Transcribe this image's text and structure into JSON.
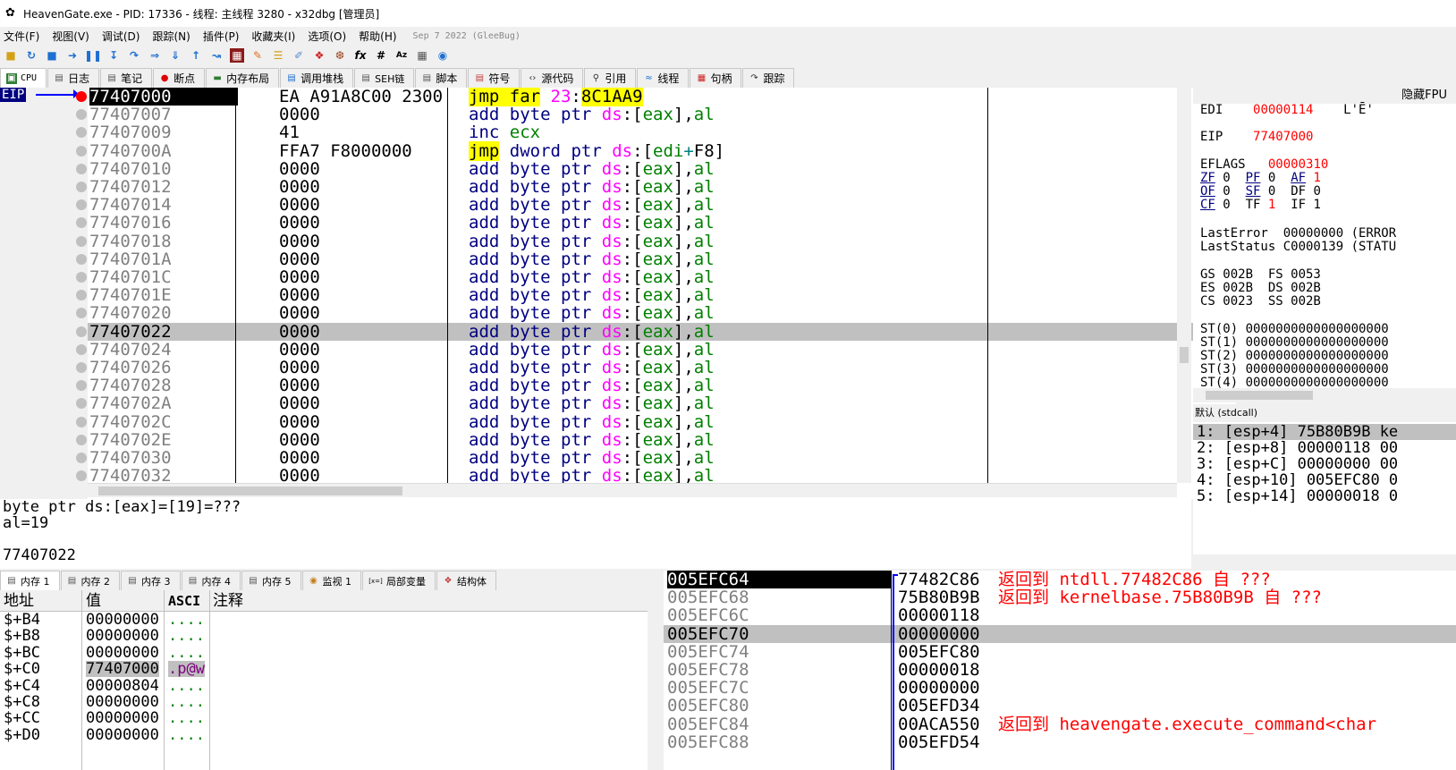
{
  "window": {
    "title": "HeavenGate.exe - PID: 17336 - 线程: 主线程 3280 - x32dbg [管理员]"
  },
  "menu": {
    "items": [
      "文件(F)",
      "视图(V)",
      "调试(D)",
      "跟踪(N)",
      "插件(P)",
      "收藏夹(I)",
      "选项(O)",
      "帮助(H)"
    ],
    "version": "Sep 7 2022 (GleeBug)"
  },
  "toolbar": {
    "icons": [
      "open-icon",
      "restart-icon",
      "stop-icon",
      "run-icon",
      "pause-icon",
      "step-into-icon",
      "step-over-icon",
      "trace-into-icon",
      "trace-over-icon",
      "run-to-user-icon",
      "run-to-return-icon",
      "break-icon",
      "patch-icon",
      "comment-icon",
      "label-icon",
      "bookmark-icon",
      "function-icon",
      "fx-icon",
      "hash-icon",
      "font-icon",
      "calculator-icon",
      "settings-icon"
    ],
    "fx": "fx",
    "hash": "#",
    "font": "Az"
  },
  "main_tabs": [
    {
      "label": "CPU",
      "icon": "cpu-icon",
      "active": true
    },
    {
      "label": "日志",
      "icon": "log-icon"
    },
    {
      "label": "笔记",
      "icon": "notes-icon"
    },
    {
      "label": "断点",
      "icon": "breakpoint-icon"
    },
    {
      "label": "内存布局",
      "icon": "memory-map-icon"
    },
    {
      "label": "调用堆栈",
      "icon": "callstack-icon"
    },
    {
      "label": "SEH链",
      "icon": "seh-icon"
    },
    {
      "label": "脚本",
      "icon": "script-icon"
    },
    {
      "label": "符号",
      "icon": "symbols-icon"
    },
    {
      "label": "源代码",
      "icon": "source-icon"
    },
    {
      "label": "引用",
      "icon": "references-icon"
    },
    {
      "label": "线程",
      "icon": "threads-icon"
    },
    {
      "label": "句柄",
      "icon": "handles-icon"
    },
    {
      "label": "跟踪",
      "icon": "trace-icon"
    }
  ],
  "disasm": {
    "eip_label": "EIP",
    "rows": [
      {
        "addr": "77407000",
        "bytes": "EA A91A8C00 2300",
        "instr": "jmp far 23:8C1AA9",
        "kind": "jmpfar",
        "current": true
      },
      {
        "addr": "77407007",
        "bytes": "0000",
        "instr": "add byte ptr ds:[eax],al",
        "kind": "add"
      },
      {
        "addr": "77407009",
        "bytes": "41",
        "instr": "inc ecx",
        "kind": "inc"
      },
      {
        "addr": "7740700A",
        "bytes": "FFA7 F8000000",
        "instr": "jmp dword ptr ds:[edi+F8]",
        "kind": "jmpdw"
      },
      {
        "addr": "77407010",
        "bytes": "0000",
        "instr": "add byte ptr ds:[eax],al",
        "kind": "add"
      },
      {
        "addr": "77407012",
        "bytes": "0000",
        "instr": "add byte ptr ds:[eax],al",
        "kind": "add"
      },
      {
        "addr": "77407014",
        "bytes": "0000",
        "instr": "add byte ptr ds:[eax],al",
        "kind": "add"
      },
      {
        "addr": "77407016",
        "bytes": "0000",
        "instr": "add byte ptr ds:[eax],al",
        "kind": "add"
      },
      {
        "addr": "77407018",
        "bytes": "0000",
        "instr": "add byte ptr ds:[eax],al",
        "kind": "add"
      },
      {
        "addr": "7740701A",
        "bytes": "0000",
        "instr": "add byte ptr ds:[eax],al",
        "kind": "add"
      },
      {
        "addr": "7740701C",
        "bytes": "0000",
        "instr": "add byte ptr ds:[eax],al",
        "kind": "add"
      },
      {
        "addr": "7740701E",
        "bytes": "0000",
        "instr": "add byte ptr ds:[eax],al",
        "kind": "add"
      },
      {
        "addr": "77407020",
        "bytes": "0000",
        "instr": "add byte ptr ds:[eax],al",
        "kind": "add"
      },
      {
        "addr": "77407022",
        "bytes": "0000",
        "instr": "add byte ptr ds:[eax],al",
        "kind": "add",
        "selected": true
      },
      {
        "addr": "77407024",
        "bytes": "0000",
        "instr": "add byte ptr ds:[eax],al",
        "kind": "add"
      },
      {
        "addr": "77407026",
        "bytes": "0000",
        "instr": "add byte ptr ds:[eax],al",
        "kind": "add"
      },
      {
        "addr": "77407028",
        "bytes": "0000",
        "instr": "add byte ptr ds:[eax],al",
        "kind": "add"
      },
      {
        "addr": "7740702A",
        "bytes": "0000",
        "instr": "add byte ptr ds:[eax],al",
        "kind": "add"
      },
      {
        "addr": "7740702C",
        "bytes": "0000",
        "instr": "add byte ptr ds:[eax],al",
        "kind": "add"
      },
      {
        "addr": "7740702E",
        "bytes": "0000",
        "instr": "add byte ptr ds:[eax],al",
        "kind": "add"
      },
      {
        "addr": "77407030",
        "bytes": "0000",
        "instr": "add byte ptr ds:[eax],al",
        "kind": "add"
      },
      {
        "addr": "77407032",
        "bytes": "0000",
        "instr": "add byte ptr ds:[eax],al",
        "kind": "add"
      }
    ]
  },
  "info": {
    "lines": [
      "byte ptr ds:[eax]=[19]=???",
      "al=19",
      "",
      "77407022"
    ]
  },
  "registers": {
    "header": "隐藏FPU",
    "edi": {
      "name": "EDI",
      "value": "00000114",
      "extra": "L'Ē'"
    },
    "eip": {
      "name": "EIP",
      "value": "77407000"
    },
    "eflags": {
      "name": "EFLAGS",
      "value": "00000310"
    },
    "flags": [
      [
        {
          "n": "ZF",
          "v": "0",
          "u": true,
          "red": false
        },
        {
          "n": "PF",
          "v": "0",
          "u": true,
          "red": false
        },
        {
          "n": "AF",
          "v": "1",
          "u": true,
          "red": true
        }
      ],
      [
        {
          "n": "OF",
          "v": "0",
          "u": true,
          "red": false
        },
        {
          "n": "SF",
          "v": "0",
          "u": true,
          "red": false
        },
        {
          "n": "DF",
          "v": "0",
          "u": false,
          "red": false
        }
      ],
      [
        {
          "n": "CF",
          "v": "0",
          "u": true,
          "red": false
        },
        {
          "n": "TF",
          "v": "1",
          "u": false,
          "red": true
        },
        {
          "n": "IF",
          "v": "1",
          "u": false,
          "red": false
        }
      ]
    ],
    "last_error": "LastError  00000000 (ERROR",
    "last_status": "LastStatus C0000139 (STATU",
    "segs": [
      "GS 002B  FS 0053",
      "ES 002B  DS 002B",
      "CS 0023  SS 002B"
    ],
    "st": [
      "ST(0) 0000000000000000000",
      "ST(1) 0000000000000000000",
      "ST(2) 0000000000000000000",
      "ST(3) 0000000000000000000",
      "ST(4) 0000000000000000000"
    ]
  },
  "callconv": {
    "header": "默认 (stdcall)",
    "rows": [
      "1: [esp+4] 75B80B9B ke",
      "2: [esp+8] 00000118 00",
      "3: [esp+C] 00000000 00",
      "4: [esp+10] 005EFC80 0",
      "5: [esp+14] 00000018 0"
    ]
  },
  "mem_tabs": [
    {
      "label": "内存 1",
      "active": true
    },
    {
      "label": "内存 2"
    },
    {
      "label": "内存 3"
    },
    {
      "label": "内存 4"
    },
    {
      "label": "内存 5"
    },
    {
      "label": "监视 1"
    },
    {
      "label": "局部变量",
      "prefix": "[x=]"
    },
    {
      "label": "结构体"
    }
  ],
  "memory": {
    "headers": [
      "地址",
      "值",
      "ASCI",
      "注释"
    ],
    "rows": [
      {
        "a": "$+B4",
        "v": "00000000",
        "s": "...."
      },
      {
        "a": "$+B8",
        "v": "00000000",
        "s": "...."
      },
      {
        "a": "$+BC",
        "v": "00000000",
        "s": "...."
      },
      {
        "a": "$+C0",
        "v": "77407000",
        "s": ".p@w",
        "hl": true
      },
      {
        "a": "$+C4",
        "v": "00000804",
        "s": "...."
      },
      {
        "a": "$+C8",
        "v": "00000000",
        "s": "...."
      },
      {
        "a": "$+CC",
        "v": "00000000",
        "s": "...."
      },
      {
        "a": "$+D0",
        "v": "00000000",
        "s": "...."
      }
    ]
  },
  "stack": {
    "rows": [
      {
        "a": "005EFC64",
        "v": "77482C86",
        "c": "返回到 ntdll.77482C86 自 ???",
        "cur": true
      },
      {
        "a": "005EFC68",
        "v": "75B80B9B",
        "c": "返回到 kernelbase.75B80B9B 自 ???"
      },
      {
        "a": "005EFC6C",
        "v": "00000118",
        "c": ""
      },
      {
        "a": "005EFC70",
        "v": "00000000",
        "c": "",
        "sel": true
      },
      {
        "a": "005EFC74",
        "v": "005EFC80",
        "c": ""
      },
      {
        "a": "005EFC78",
        "v": "00000018",
        "c": ""
      },
      {
        "a": "005EFC7C",
        "v": "00000000",
        "c": ""
      },
      {
        "a": "005EFC80",
        "v": "005EFD34",
        "c": ""
      },
      {
        "a": "005EFC84",
        "v": "00ACA550",
        "c": "返回到 heavengate.execute_command<char"
      },
      {
        "a": "005EFC88",
        "v": "005EFD54",
        "c": ""
      }
    ]
  }
}
